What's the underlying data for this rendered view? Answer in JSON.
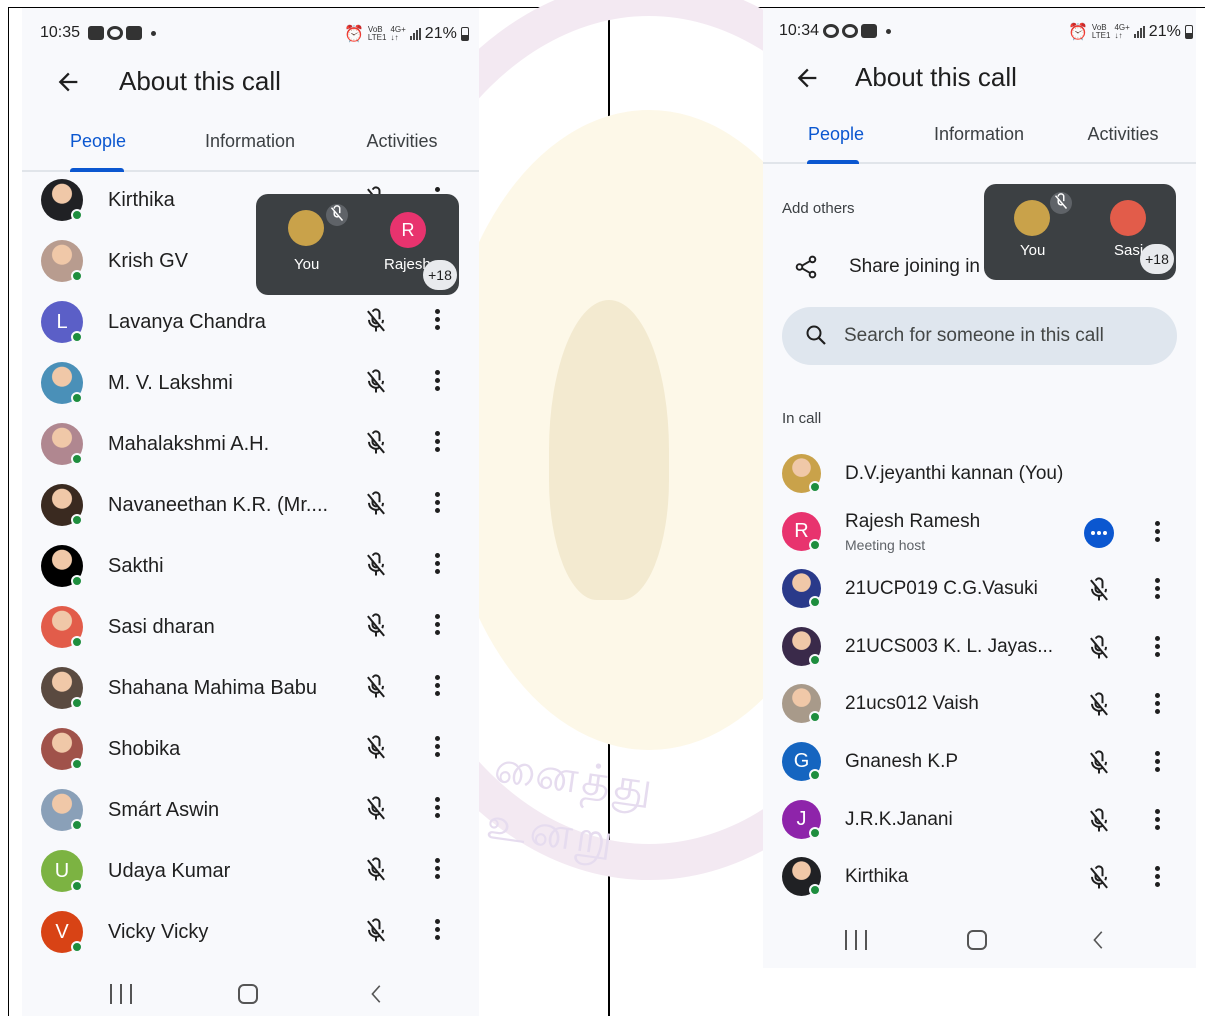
{
  "colors": {
    "accent": "#0b57d0",
    "presence": "#1e8e3e",
    "pip_bg": "#3c4043",
    "search_bg": "#dfe6ee"
  },
  "watermark_text": "னைத்து உனறு",
  "left": {
    "status": {
      "time": "10:35",
      "net_top": "VoB",
      "net_bottom": "LTE1",
      "gen_top": "4G+",
      "gen_bottom": "↓↑",
      "battery": "21%"
    },
    "title": "About this call",
    "tabs": [
      "People",
      "Information",
      "Activities"
    ],
    "pip": {
      "tile1": "You",
      "tile2": "Rajesh",
      "tile2_initial": "R",
      "more": "+18"
    },
    "participants": [
      {
        "name": "Kirthika",
        "avatar": "photo",
        "color": "#202124"
      },
      {
        "name": "Krish GV",
        "avatar": "photo",
        "color": "#b89c8f"
      },
      {
        "name": "Lavanya Chandra",
        "avatar": "L",
        "color": "#5b5fc7"
      },
      {
        "name": "M. V. Lakshmi",
        "avatar": "photo",
        "color": "#4a90b8"
      },
      {
        "name": "Mahalakshmi A.H.",
        "avatar": "photo",
        "color": "#b08790"
      },
      {
        "name": "Navaneethan K.R. (Mr....",
        "avatar": "photo",
        "color": "#3a2a20"
      },
      {
        "name": "Sakthi",
        "avatar": "photo",
        "color": "#000000"
      },
      {
        "name": "Sasi dharan",
        "avatar": "photo",
        "color": "#e25c4a"
      },
      {
        "name": "Shahana Mahima Babu",
        "avatar": "photo",
        "color": "#5a4a40"
      },
      {
        "name": "Shobika",
        "avatar": "photo",
        "color": "#a0524a"
      },
      {
        "name": "Smárt Aswin",
        "avatar": "photo",
        "color": "#8aa0b8"
      },
      {
        "name": "Udaya Kumar",
        "avatar": "U",
        "color": "#7cb342"
      },
      {
        "name": "Vicky Vicky",
        "avatar": "V",
        "color": "#d84315"
      }
    ]
  },
  "right": {
    "status": {
      "time": "10:34",
      "net_top": "VoB",
      "net_bottom": "LTE1",
      "gen_top": "4G+",
      "gen_bottom": "↓↑",
      "battery": "21%"
    },
    "title": "About this call",
    "tabs": [
      "People",
      "Information",
      "Activities"
    ],
    "add_others": "Add others",
    "share_text": "Share joining in",
    "pip": {
      "tile1": "You",
      "tile2": "Sasi",
      "more": "+18"
    },
    "search_placeholder": "Search for someone in this call",
    "in_call": "In call",
    "participants": [
      {
        "name": "D.V.jeyanthi kannan (You)",
        "sub": "",
        "avatar": "photo",
        "color": "#c9a24a",
        "controls": "none"
      },
      {
        "name": "Rajesh Ramesh",
        "sub": "Meeting host",
        "avatar": "R",
        "color": "#e8336e",
        "controls": "host"
      },
      {
        "name": "21UCP019 C.G.Vasuki",
        "sub": "",
        "avatar": "photo",
        "color": "#2a3a8a",
        "controls": "mic"
      },
      {
        "name": "21UCS003 K. L. Jayas...",
        "sub": "",
        "avatar": "photo",
        "color": "#3a2a4a",
        "controls": "mic"
      },
      {
        "name": "21ucs012 Vaish",
        "sub": "",
        "avatar": "photo",
        "color": "#a89a8a",
        "controls": "mic"
      },
      {
        "name": "Gnanesh K.P",
        "sub": "",
        "avatar": "G",
        "color": "#1565c0",
        "controls": "mic"
      },
      {
        "name": "J.R.K.Janani",
        "sub": "",
        "avatar": "J",
        "color": "#8e24aa",
        "controls": "mic"
      },
      {
        "name": "Kirthika",
        "sub": "",
        "avatar": "photo",
        "color": "#202124",
        "controls": "mic"
      }
    ]
  }
}
